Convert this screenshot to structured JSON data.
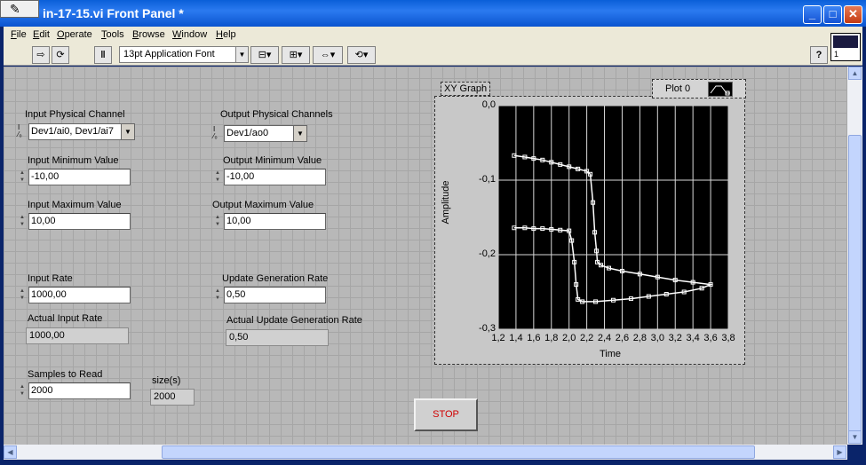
{
  "window": {
    "title": "in-17-15.vi Front Panel *",
    "colors": {
      "titlebar": "#0a5fd8",
      "panel": "#b8b8b8",
      "plot_bg": "#000000",
      "stop_text": "#d00000"
    }
  },
  "menu": [
    "File",
    "Edit",
    "Operate",
    "Tools",
    "Browse",
    "Window",
    "Help"
  ],
  "menu_underline": [
    "F",
    "E",
    "O",
    "T",
    "B",
    "W",
    "H"
  ],
  "toolbar": {
    "run_icon": "run-arrow-icon",
    "run_continuous_icon": "run-continuously-icon",
    "pause_icon": "pause-icon",
    "font": "13pt Application Font",
    "align_icon": "align-objects-icon",
    "distribute_icon": "distribute-objects-icon",
    "resize_icon": "resize-objects-icon",
    "reorder_icon": "reorder-icon",
    "help_label": "?",
    "vi_icon_number": "1"
  },
  "controls": {
    "input_channel": {
      "label": "Input Physical Channel",
      "value": "Dev1/ai0, Dev1/ai7"
    },
    "output_channel": {
      "label": "Output Physical Channels",
      "value": "Dev1/ao0"
    },
    "input_min": {
      "label": "Input Minimum Value",
      "value": "-10,00"
    },
    "output_min": {
      "label": "Output Minimum Value",
      "value": "-10,00"
    },
    "input_max": {
      "label": "Input Maximum Value",
      "value": "10,00"
    },
    "output_max": {
      "label": "Output Maximum Value",
      "value": "10,00"
    },
    "input_rate": {
      "label": "Input Rate",
      "value": "1000,00"
    },
    "update_rate": {
      "label": "Update Generation Rate",
      "value": "0,50"
    },
    "actual_input_rate": {
      "label": "Actual Input Rate",
      "value": "1000,00"
    },
    "actual_update_rate": {
      "label": "Actual Update Generation Rate",
      "value": "0,50"
    },
    "samples": {
      "label": "Samples to Read",
      "value": "2000"
    },
    "size": {
      "label": "size(s)",
      "value": "2000"
    }
  },
  "graph": {
    "caption": "XY Graph",
    "legend_name": "Plot 0",
    "xlabel": "Time",
    "ylabel": "Amplitude"
  },
  "chart_data": {
    "type": "scatter",
    "xlabel": "Time",
    "ylabel": "Amplitude",
    "xlim": [
      1.2,
      3.8
    ],
    "ylim": [
      -0.3,
      0.0
    ],
    "x_ticks": [
      "1,2",
      "1,4",
      "1,6",
      "1,8",
      "2,0",
      "2,2",
      "2,4",
      "2,6",
      "2,8",
      "3,0",
      "3,2",
      "3,4",
      "3,6",
      "3,8"
    ],
    "y_ticks": [
      "0,0",
      "-0,1",
      "-0,2",
      "-0,3"
    ],
    "grid": true,
    "series": [
      {
        "name": "Plot 0",
        "color": "#ffffff",
        "x": [
          1.38,
          1.5,
          1.6,
          1.7,
          1.8,
          1.9,
          2.0,
          2.1,
          2.2,
          2.24,
          2.27,
          2.29,
          2.31,
          2.32,
          2.36,
          2.45,
          2.6,
          2.8,
          3.0,
          3.2,
          3.4,
          3.6,
          3.5,
          3.3,
          3.1,
          2.9,
          2.7,
          2.5,
          2.3,
          2.15,
          2.1,
          2.08,
          2.06,
          2.03,
          2.0,
          1.9,
          1.8,
          1.7,
          1.6,
          1.5,
          1.38
        ],
        "y": [
          -0.067,
          -0.069,
          -0.071,
          -0.073,
          -0.076,
          -0.079,
          -0.082,
          -0.085,
          -0.088,
          -0.092,
          -0.13,
          -0.17,
          -0.195,
          -0.21,
          -0.214,
          -0.218,
          -0.222,
          -0.226,
          -0.23,
          -0.234,
          -0.237,
          -0.24,
          -0.245,
          -0.25,
          -0.253,
          -0.256,
          -0.259,
          -0.261,
          -0.263,
          -0.263,
          -0.26,
          -0.24,
          -0.21,
          -0.181,
          -0.168,
          -0.167,
          -0.166,
          -0.165,
          -0.165,
          -0.164,
          -0.164
        ]
      }
    ]
  },
  "stop_label": "STOP"
}
